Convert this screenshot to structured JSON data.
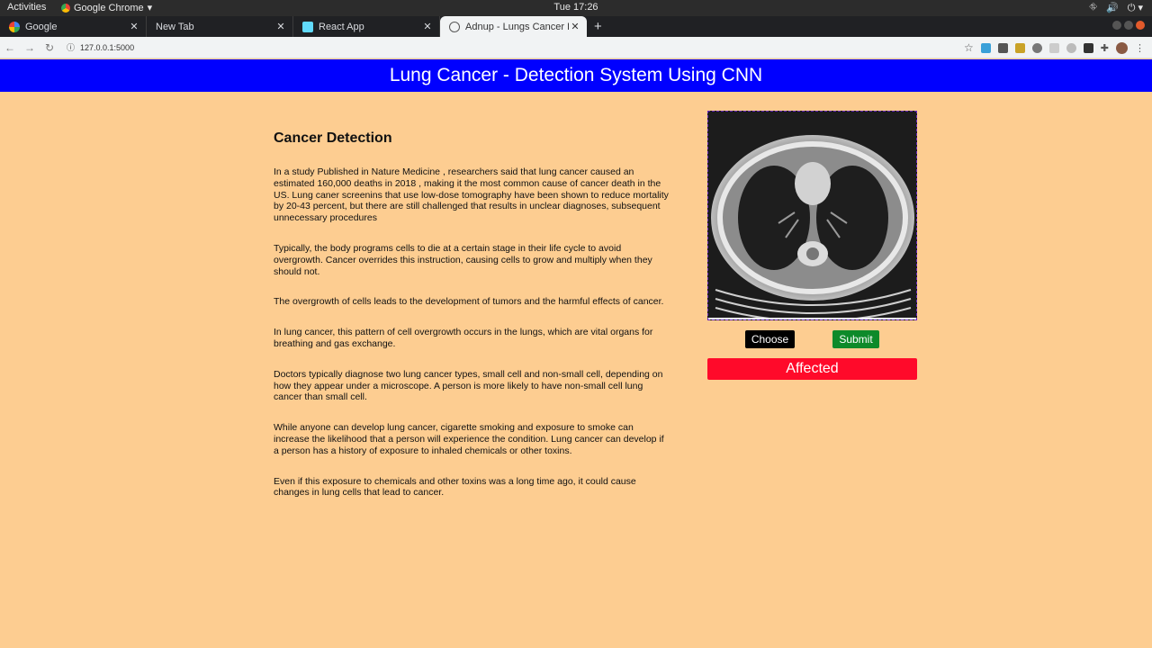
{
  "system": {
    "activities": "Activities",
    "app_menu": "Google Chrome",
    "clock": "Tue 17:26"
  },
  "tabs": [
    {
      "label": "Google",
      "icon": "google-icon"
    },
    {
      "label": "New Tab",
      "icon": ""
    },
    {
      "label": "React App",
      "icon": "react-icon"
    },
    {
      "label": "Adnup - Lungs Cancer Det",
      "icon": "globe-icon",
      "active": true
    }
  ],
  "address_bar": {
    "url": "127.0.0.1:5000"
  },
  "header": {
    "title": "Lung Cancer - Detection System Using CNN"
  },
  "article": {
    "heading": "Cancer Detection",
    "paragraphs": [
      "In a study Published in Nature Medicine , researchers said that lung cancer caused an estimated 160,000 deaths in 2018 , making it the most common cause of cancer death in the US. Lung caner screenins that use low-dose tomography have been shown to reduce mortality by 20-43 percent, but there are still challenged that results in unclear diagnoses, subsequent unnecessary procedures",
      "Typically, the body programs cells to die at a certain stage in their life cycle to avoid overgrowth. Cancer overrides this instruction, causing cells to grow and multiply when they should not.",
      "The overgrowth of cells leads to the development of tumors and the harmful effects of cancer.",
      "In lung cancer, this pattern of cell overgrowth occurs in the lungs, which are vital organs for breathing and gas exchange.",
      "Doctors typically diagnose two lung cancer types, small cell and non-small cell, depending on how they appear under a microscope. A person is more likely to have non-small cell lung cancer than small cell.",
      "While anyone can develop lung cancer, cigarette smoking and exposure to smoke can increase the likelihood that a person will experience the condition. Lung cancer can develop if a person has a history of exposure to inhaled chemicals or other toxins.",
      "Even if this exposure to chemicals and other toxins was a long time ago, it could cause changes in lung cells that lead to cancer."
    ]
  },
  "detector": {
    "choose_label": "Choose",
    "submit_label": "Submit",
    "result": "Affected",
    "colors": {
      "banner": "#0000ff",
      "background": "#fdcd91",
      "submit": "#0d8a2a",
      "result": "#ff0a2a"
    }
  }
}
